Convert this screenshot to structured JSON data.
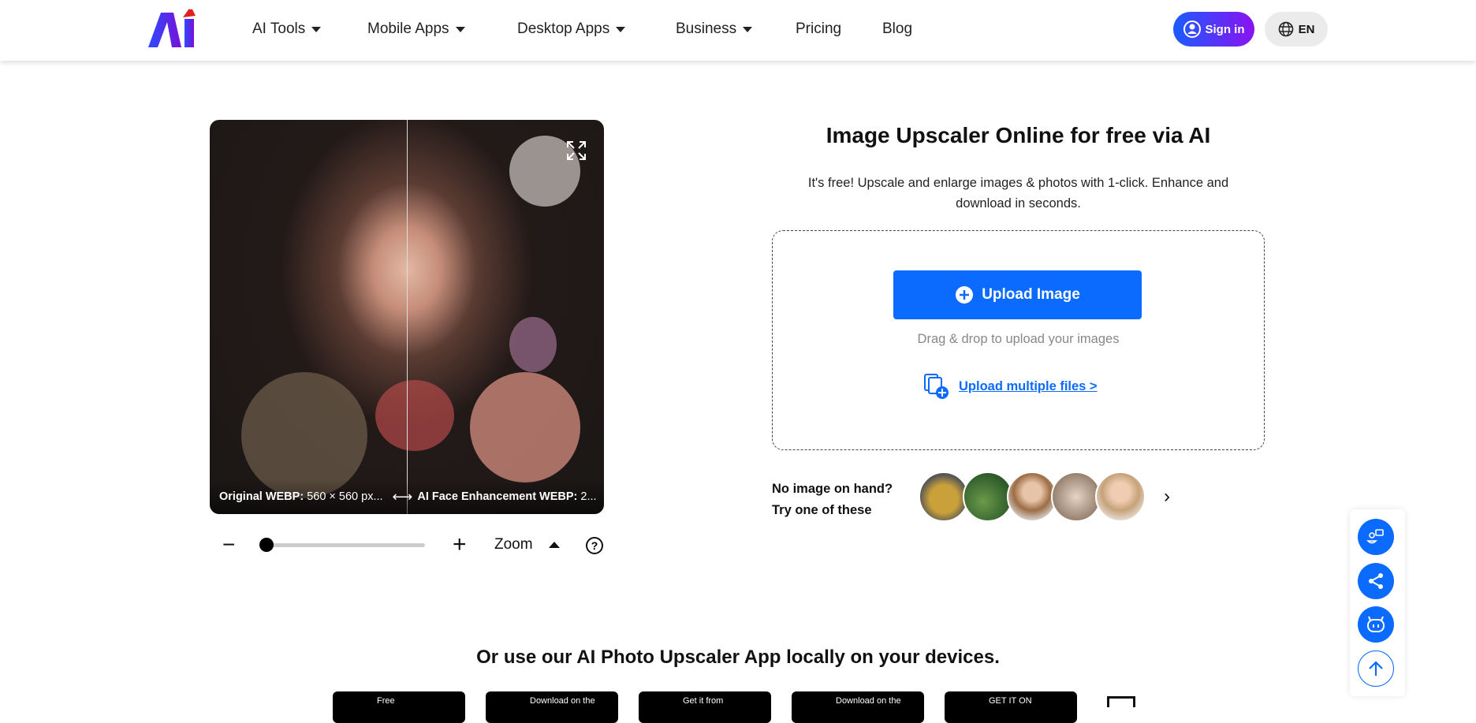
{
  "header": {
    "nav": [
      {
        "label": "AI Tools",
        "dropdown": true
      },
      {
        "label": "Mobile Apps",
        "dropdown": true
      },
      {
        "label": "Desktop Apps",
        "dropdown": true
      },
      {
        "label": "Business",
        "dropdown": true
      },
      {
        "label": "Pricing",
        "dropdown": false
      },
      {
        "label": "Blog",
        "dropdown": false
      }
    ],
    "sign_in": "Sign in",
    "language": "EN",
    "brand_colors": [
      "#1a5cff",
      "#8a12f0"
    ]
  },
  "preview": {
    "original_label": "Original WEBP:",
    "original_value": "560 × 560 px...",
    "enhanced_label": "AI Face Enhancement WEBP:",
    "enhanced_value": "2...",
    "zoom_label": "Zoom",
    "zoom_level": 0
  },
  "main": {
    "title": "Image Upscaler Online for free via AI",
    "subtitle": "It's free! Upscale and enlarge images & photos with 1-click. Enhance and download in seconds.",
    "upload_button": "Upload Image",
    "drag_text": "Drag & drop to upload your images",
    "multi_link": "Upload multiple files >",
    "no_image_line1": "No image on hand?",
    "no_image_line2": "Try one of these",
    "accent": "#0b6bff"
  },
  "apps": {
    "heading": "Or use our AI Photo Upscaler App locally on your devices.",
    "stores": [
      "Free",
      "Download on the",
      "Get it from",
      "Download on the",
      "GET IT ON"
    ]
  }
}
